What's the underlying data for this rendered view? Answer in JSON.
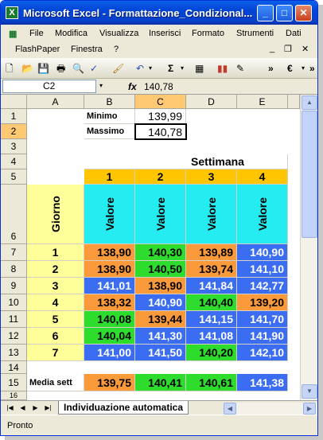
{
  "window": {
    "title": "Microsoft Excel - Formattazione_Condizional..."
  },
  "menu": {
    "items": [
      "File",
      "Modifica",
      "Visualizza",
      "Inserisci",
      "Formato",
      "Strumenti",
      "Dati"
    ],
    "items2": [
      "FlashPaper",
      "Finestra",
      "?"
    ]
  },
  "formula": {
    "cell_ref": "C2",
    "fx": "fx",
    "value": "140,78"
  },
  "columns": [
    "A",
    "B",
    "C",
    "D",
    "E"
  ],
  "rows": [
    "1",
    "2",
    "3",
    "4",
    "5",
    "6",
    "7",
    "8",
    "9",
    "10",
    "11",
    "12",
    "13",
    "14",
    "15",
    "16"
  ],
  "stats": {
    "min_label": "Minimo",
    "min_value": "139,99",
    "max_label": "Massimo",
    "max_value": "140,78"
  },
  "table": {
    "header": "Settimana",
    "weeks": [
      "1",
      "2",
      "3",
      "4"
    ],
    "day_label": "Giorno",
    "value_label": "Valore",
    "days": [
      "1",
      "2",
      "3",
      "4",
      "5",
      "6",
      "7"
    ],
    "values": [
      [
        "138,90",
        "140,30",
        "139,89",
        "140,90"
      ],
      [
        "138,90",
        "140,50",
        "139,74",
        "141,10"
      ],
      [
        "141,01",
        "138,90",
        "141,84",
        "142,77"
      ],
      [
        "138,32",
        "140,90",
        "140,40",
        "139,20"
      ],
      [
        "140,08",
        "139,44",
        "141,15",
        "141,70"
      ],
      [
        "140,04",
        "141,30",
        "141,08",
        "141,90"
      ],
      [
        "141,00",
        "141,50",
        "140,20",
        "142,10"
      ]
    ],
    "colors": [
      [
        "orange",
        "green",
        "orange",
        "blue"
      ],
      [
        "orange",
        "green",
        "orange",
        "blue"
      ],
      [
        "blue",
        "orange",
        "blue",
        "blue"
      ],
      [
        "orange",
        "blue",
        "green",
        "orange"
      ],
      [
        "green",
        "orange",
        "blue",
        "blue"
      ],
      [
        "green",
        "blue",
        "blue",
        "blue"
      ],
      [
        "blue",
        "blue",
        "green",
        "blue"
      ]
    ],
    "avg_label": "Media sett",
    "avg_values": [
      "139,75",
      "140,41",
      "140,61",
      "141,38"
    ],
    "avg_colors": [
      "orange",
      "green",
      "green",
      "blue"
    ]
  },
  "sheet_tab": "Individuazione automatica",
  "status": "Pronto"
}
